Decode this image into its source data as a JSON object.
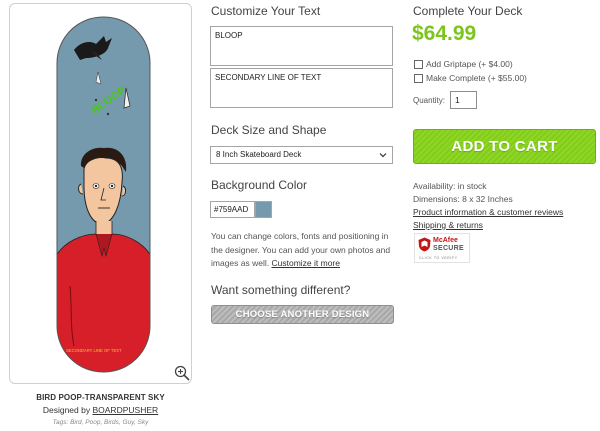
{
  "preview": {
    "deck_color": "#759AAD",
    "deck_text": "SECONDARY LINE OF TEXT",
    "zoom_icon": "magnifier-plus-icon"
  },
  "design": {
    "title": "BIRD POOP-TRANSPARENT SKY",
    "designed_by_prefix": "Designed by",
    "designer": "BOARDPUSHER",
    "tags": "Tags: Bird, Poop, Birds, Guy, Sky"
  },
  "customize": {
    "heading": "Customize Your Text",
    "line1": "BLOOP",
    "line2": "SECONDARY LINE OF TEXT"
  },
  "deck": {
    "heading": "Deck Size and Shape",
    "selected": "8 Inch Skateboard Deck"
  },
  "background": {
    "heading": "Background Color",
    "value": "#759AAD",
    "swatch_color": "#759AAD"
  },
  "help": {
    "text": "You can change colors, fonts and positioning in the designer. You can add your own photos and images as well.",
    "link": "Customize it more"
  },
  "different": {
    "heading": "Want something different?",
    "button": "CHOOSE ANOTHER DESIGN"
  },
  "purchase": {
    "heading": "Complete Your Deck",
    "price": "$64.99",
    "griptape": "Add Griptape (+ $4.00)",
    "complete": "Make Complete (+ $55.00)",
    "quantity_label": "Quantity:",
    "quantity": "1",
    "add_to_cart": "ADD TO CART",
    "availability": "Availability: in stock",
    "dimensions": "Dimensions: 8 x 32 Inches",
    "product_info": "Product information & customer reviews",
    "shipping": "Shipping & returns",
    "accent": "#7cc51c"
  },
  "badge": {
    "brand": "McAfee",
    "secure": "SECURE",
    "verify": "CLICK TO VERIFY"
  }
}
